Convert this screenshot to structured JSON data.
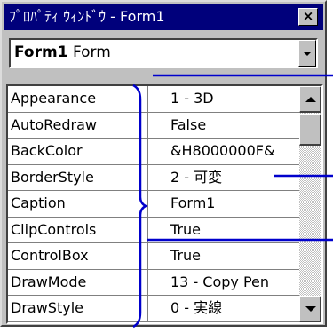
{
  "window": {
    "title": "ﾌﾟﾛﾊﾟﾃｨ ｳｨﾝﾄﾞｳ - Form1",
    "close_label": "×"
  },
  "object_selector": {
    "object_name": "Form1",
    "object_type": "Form"
  },
  "properties": [
    {
      "name": "Appearance",
      "value": "1 - 3D"
    },
    {
      "name": "AutoRedraw",
      "value": "False"
    },
    {
      "name": "BackColor",
      "value": "&H8000000F&"
    },
    {
      "name": "BorderStyle",
      "value": "2 - 可変"
    },
    {
      "name": "Caption",
      "value": "Form1"
    },
    {
      "name": "ClipControls",
      "value": "True"
    },
    {
      "name": "ControlBox",
      "value": "True"
    },
    {
      "name": "DrawMode",
      "value": "13 - Copy Pen"
    },
    {
      "name": "DrawStyle",
      "value": "0 - 実線"
    }
  ],
  "colors": {
    "titlebar": "#00007b",
    "window_face": "#c0c0c0",
    "annotation": "#0000cc"
  }
}
